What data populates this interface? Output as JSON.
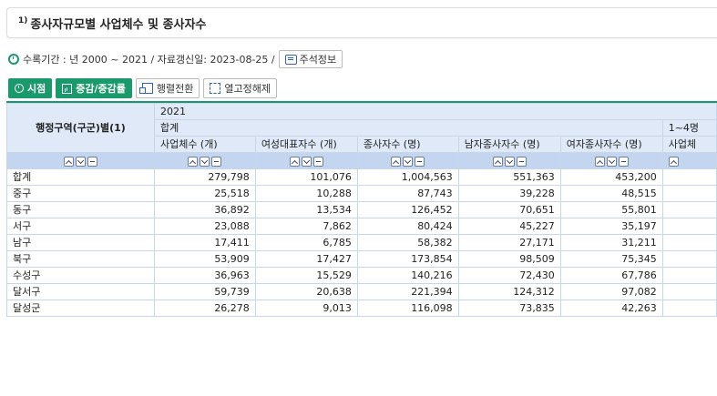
{
  "title": {
    "sup": "1)",
    "text": "종사자규모별 사업체수 및 종사자수"
  },
  "period": {
    "text": "수록기간 : 년 2000 ~ 2021 / 자료갱신일: 2023-08-25 /",
    "note_label": "주석정보"
  },
  "toolbar": {
    "time_label": "시점",
    "change_label": "증감/증감률",
    "pivot_label": "행렬전환",
    "unfix_label": "열고정해제"
  },
  "table": {
    "row_header": "행정구역(구군)별(1)",
    "year": "2021",
    "group_total": "합계",
    "group_next": "1~4명",
    "columns": [
      "사업체수 (개)",
      "여성대표자수 (개)",
      "종사자수 (명)",
      "남자종사자수 (명)",
      "여자종사자수 (명)",
      "사업체"
    ],
    "rows": [
      {
        "label": "합계",
        "values": [
          "279,798",
          "101,076",
          "1,004,563",
          "551,363",
          "453,200"
        ]
      },
      {
        "label": "중구",
        "values": [
          "25,518",
          "10,288",
          "87,743",
          "39,228",
          "48,515"
        ]
      },
      {
        "label": "동구",
        "values": [
          "36,892",
          "13,534",
          "126,452",
          "70,651",
          "55,801"
        ]
      },
      {
        "label": "서구",
        "values": [
          "23,088",
          "7,862",
          "80,424",
          "45,227",
          "35,197"
        ]
      },
      {
        "label": "남구",
        "values": [
          "17,411",
          "6,785",
          "58,382",
          "27,171",
          "31,211"
        ]
      },
      {
        "label": "북구",
        "values": [
          "53,909",
          "17,427",
          "173,854",
          "98,509",
          "75,345"
        ]
      },
      {
        "label": "수성구",
        "values": [
          "36,963",
          "15,529",
          "140,216",
          "72,430",
          "67,786"
        ]
      },
      {
        "label": "달서구",
        "values": [
          "59,739",
          "20,638",
          "221,394",
          "124,312",
          "97,082"
        ]
      },
      {
        "label": "달성군",
        "values": [
          "26,278",
          "9,013",
          "116,098",
          "73,835",
          "42,263"
        ]
      }
    ]
  },
  "colors": {
    "accent": "#1a9a6c",
    "header_bg": "#dfe9f7",
    "sorter_bg": "#c3d5ef"
  }
}
